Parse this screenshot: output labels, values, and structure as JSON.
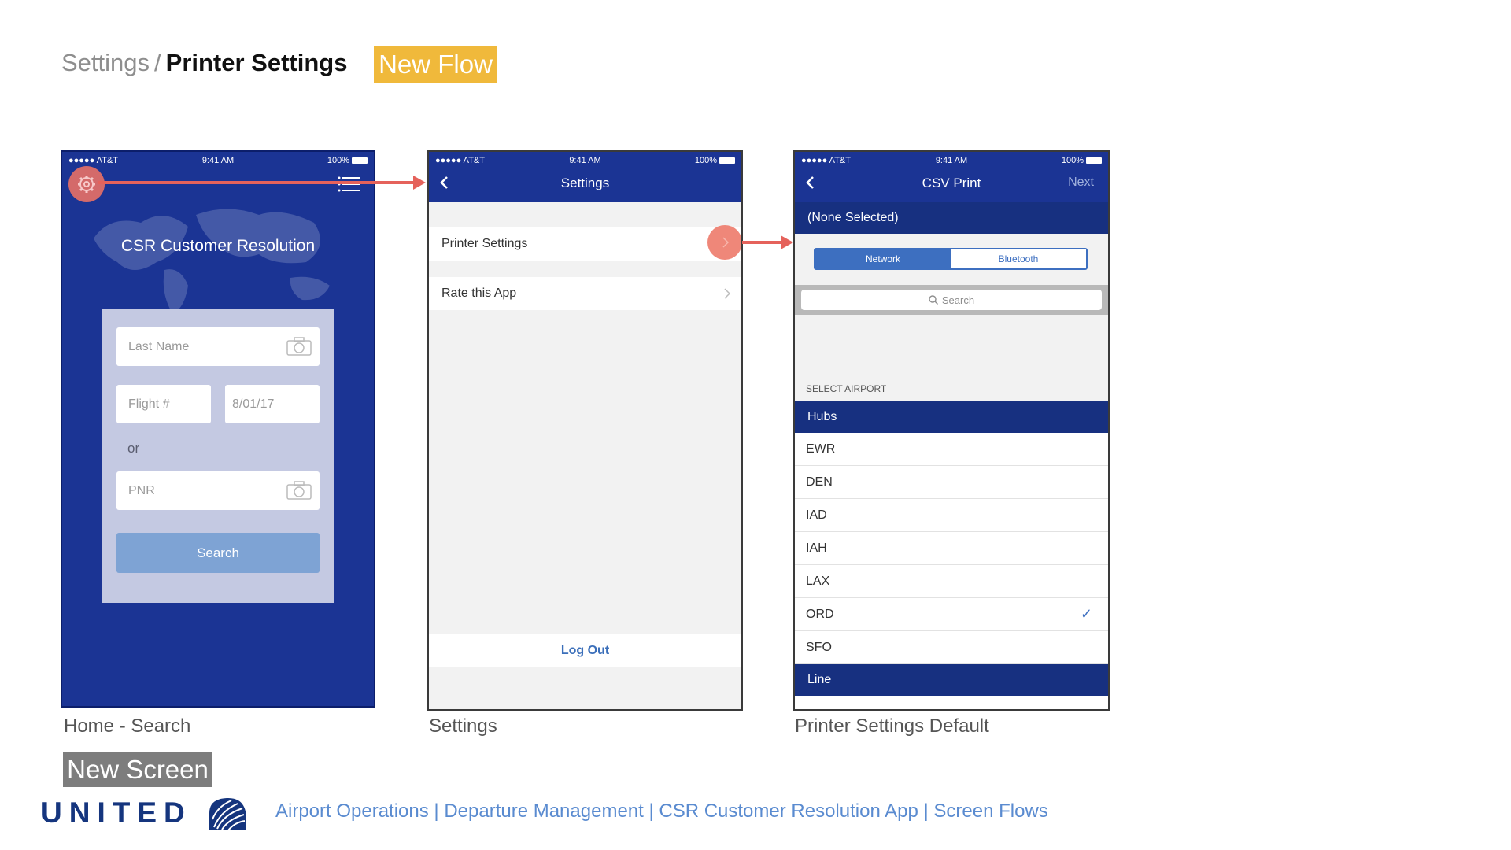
{
  "header": {
    "crumb_parent": "Settings",
    "crumb_separator": "/",
    "crumb_current": "Printer Settings",
    "badge": "New Flow"
  },
  "status_bar": {
    "carrier": "●●●●● AT&T",
    "time": "9:41 AM",
    "battery": "100%"
  },
  "screen1": {
    "title": "CSR Customer Resolution",
    "last_name_placeholder": "Last Name",
    "flight_placeholder": "Flight #",
    "date_value": "8/01/17",
    "or_label": "or",
    "pnr_placeholder": "PNR",
    "search_button": "Search",
    "caption": "Home - Search"
  },
  "screen2": {
    "title": "Settings",
    "items": [
      {
        "label": "Printer Settings"
      },
      {
        "label": "Rate this App"
      }
    ],
    "logout": "Log Out",
    "caption": "Settings"
  },
  "screen3": {
    "title": "CSV Print",
    "next": "Next",
    "none_selected": "(None Selected)",
    "segments": [
      "Network",
      "Bluetooth"
    ],
    "active_segment": "Network",
    "search_placeholder": "Search",
    "section_header": "SELECT AIRPORT",
    "hubs_header": "Hubs",
    "airports": [
      "EWR",
      "DEN",
      "IAD",
      "IAH",
      "LAX",
      "ORD",
      "SFO"
    ],
    "selected_airport": "ORD",
    "line_header": "Line",
    "caption": "Printer Settings Default"
  },
  "new_screen_badge": "New Screen",
  "brand": "UNITED",
  "footer": "Airport Operations | Departure Management | CSR Customer Resolution App | Screen Flows",
  "colors": {
    "navy": "#1b3494",
    "accent_yellow": "#f0b93b",
    "flow_arrow": "#e5625b",
    "link_blue": "#3b6fba"
  }
}
